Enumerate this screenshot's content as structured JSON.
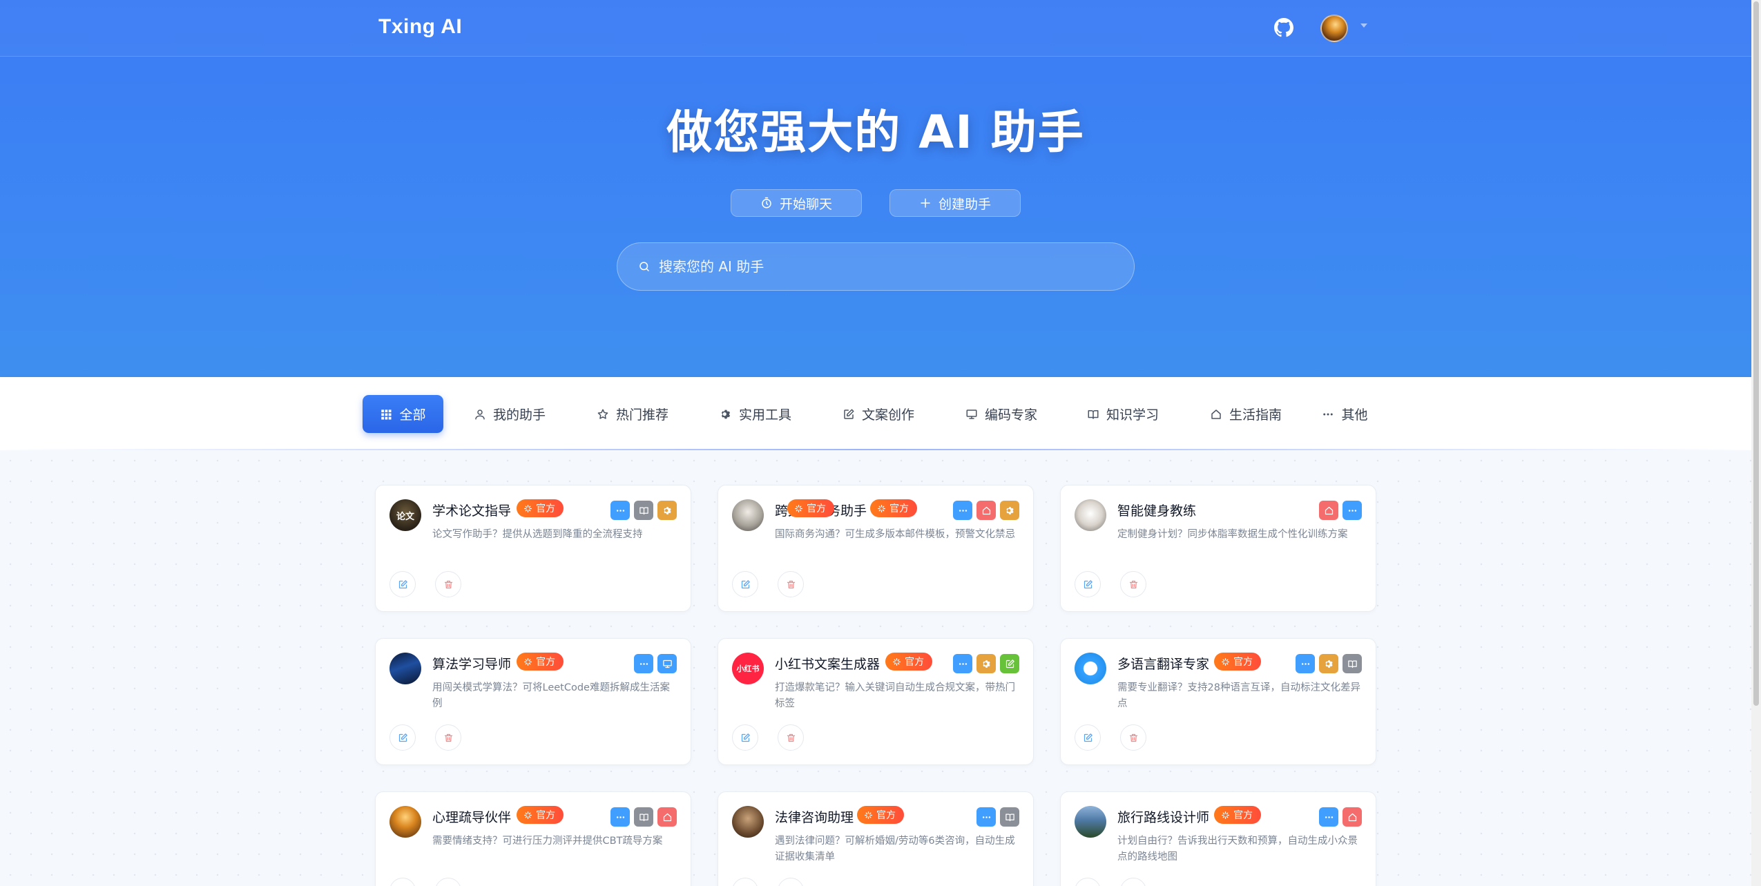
{
  "brand": "Txing AI",
  "hero": {
    "title": "做您强大的 AI 助手",
    "start_chat": "开始聊天",
    "create_assistant": "创建助手",
    "search_placeholder": "搜索您的 AI 助手"
  },
  "categories": [
    {
      "label": "全部",
      "icon": "grid-icon",
      "active": true
    },
    {
      "label": "我的助手",
      "icon": "user-icon"
    },
    {
      "label": "热门推荐",
      "icon": "star-icon"
    },
    {
      "label": "实用工具",
      "icon": "gear-icon"
    },
    {
      "label": "文案创作",
      "icon": "edit-icon"
    },
    {
      "label": "编码专家",
      "icon": "monitor-icon"
    },
    {
      "label": "知识学习",
      "icon": "book-icon"
    },
    {
      "label": "生活指南",
      "icon": "home-icon"
    },
    {
      "label": "其他",
      "icon": "more-icon"
    }
  ],
  "badge_label": "官方",
  "cards": [
    {
      "title": "学术论文指导",
      "desc": "论文写作助手？提供从选题到降重的全流程支持",
      "avatar_text": "论文",
      "tags": [
        "more",
        "book",
        "gear"
      ]
    },
    {
      "title": "跨文化商务助手",
      "desc": "国际商务沟通？可生成多版本邮件模板，预警文化禁忌",
      "avatar_text": "",
      "tags": [
        "more",
        "home",
        "gear"
      ]
    },
    {
      "title": "智能健身教练",
      "desc": "定制健身计划？同步体脂率数据生成个性化训练方案",
      "avatar_text": "",
      "tags": [
        "home",
        "more"
      ]
    },
    {
      "title": "算法学习导师",
      "desc": "用闯关模式学算法？可将LeetCode难题拆解成生活案例",
      "avatar_text": "",
      "tags": [
        "more",
        "monitor"
      ]
    },
    {
      "title": "小红书文案生成器",
      "desc": "打造爆款笔记？输入关键词自动生成合规文案，带热门标签",
      "avatar_text": "小红书",
      "tags": [
        "more",
        "gear",
        "edit"
      ]
    },
    {
      "title": "多语言翻译专家",
      "desc": "需要专业翻译？支持28种语言互译，自动标注文化差异点",
      "avatar_text": "",
      "tags": [
        "more",
        "gear",
        "book"
      ]
    },
    {
      "title": "心理疏导伙伴",
      "desc": "需要情绪支持？可进行压力测评并提供CBT疏导方案",
      "avatar_text": "",
      "tags": [
        "more",
        "book",
        "home"
      ]
    },
    {
      "title": "法律咨询助理",
      "desc": "遇到法律问题？可解析婚姻/劳动等6类咨询，自动生成证据收集清单",
      "avatar_text": "",
      "tags": [
        "more",
        "book"
      ]
    },
    {
      "title": "旅行路线设计师",
      "desc": "计划自由行？告诉我出行天数和预算，自动生成小众景点的路线地图",
      "avatar_text": "",
      "tags": [
        "more",
        "home"
      ]
    }
  ]
}
